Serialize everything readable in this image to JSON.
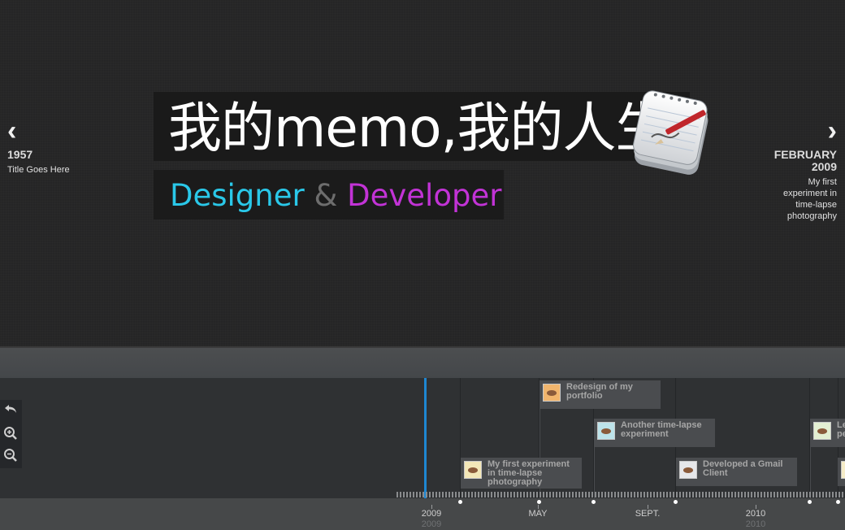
{
  "slide": {
    "headline": "我的memo,我的人生",
    "subtitle": {
      "designer": "Designer",
      "amp": "&",
      "developer": "Developer"
    },
    "icon": "notepad-pencil-icon"
  },
  "nav": {
    "prev": {
      "arrow": "‹",
      "date": "1957",
      "title": "Title Goes Here"
    },
    "next": {
      "arrow": "›",
      "date_line1": "FEBRUARY",
      "date_line2": "2009",
      "title_lines": [
        "My first",
        "experiment in",
        "time-lapse",
        "photography"
      ]
    }
  },
  "tools": {
    "back": "undo-icon",
    "zoom_in": "zoom-in-icon",
    "zoom_out": "zoom-out-icon"
  },
  "flags": [
    {
      "title": "Redesign of my portfolio",
      "lines": [
        "Redesign of my",
        "portfolio"
      ],
      "thumb_color": "#f1b56d"
    },
    {
      "title": "Another time-lapse experiment",
      "lines": [
        "Another time-lapse",
        "experiment"
      ],
      "thumb_color": "#bde3ea"
    },
    {
      "title": "My first experiment in time-lapse photography",
      "lines": [
        "My first experiment",
        "in time-lapse",
        "photography"
      ],
      "thumb_color": "#f3e7b8"
    },
    {
      "title": "Developed a Gmail Client",
      "lines": [
        "Developed a Gmail",
        "Client"
      ],
      "thumb_color": "#e6e7ea"
    },
    {
      "title": "Le pe",
      "lines": [
        "Le",
        "pe"
      ],
      "thumb_color": "#e3efd2"
    },
    {
      "title": "",
      "lines": [],
      "thumb_color": "#f5ecc8"
    }
  ],
  "axis": {
    "labels": [
      "2009",
      "MAY",
      "SEPT.",
      "2010"
    ],
    "sublabels": [
      "2009",
      "2010"
    ]
  },
  "colors": {
    "accent_now": "#1e87d2",
    "designer": "#2ac8e9",
    "developer": "#c233d6"
  }
}
